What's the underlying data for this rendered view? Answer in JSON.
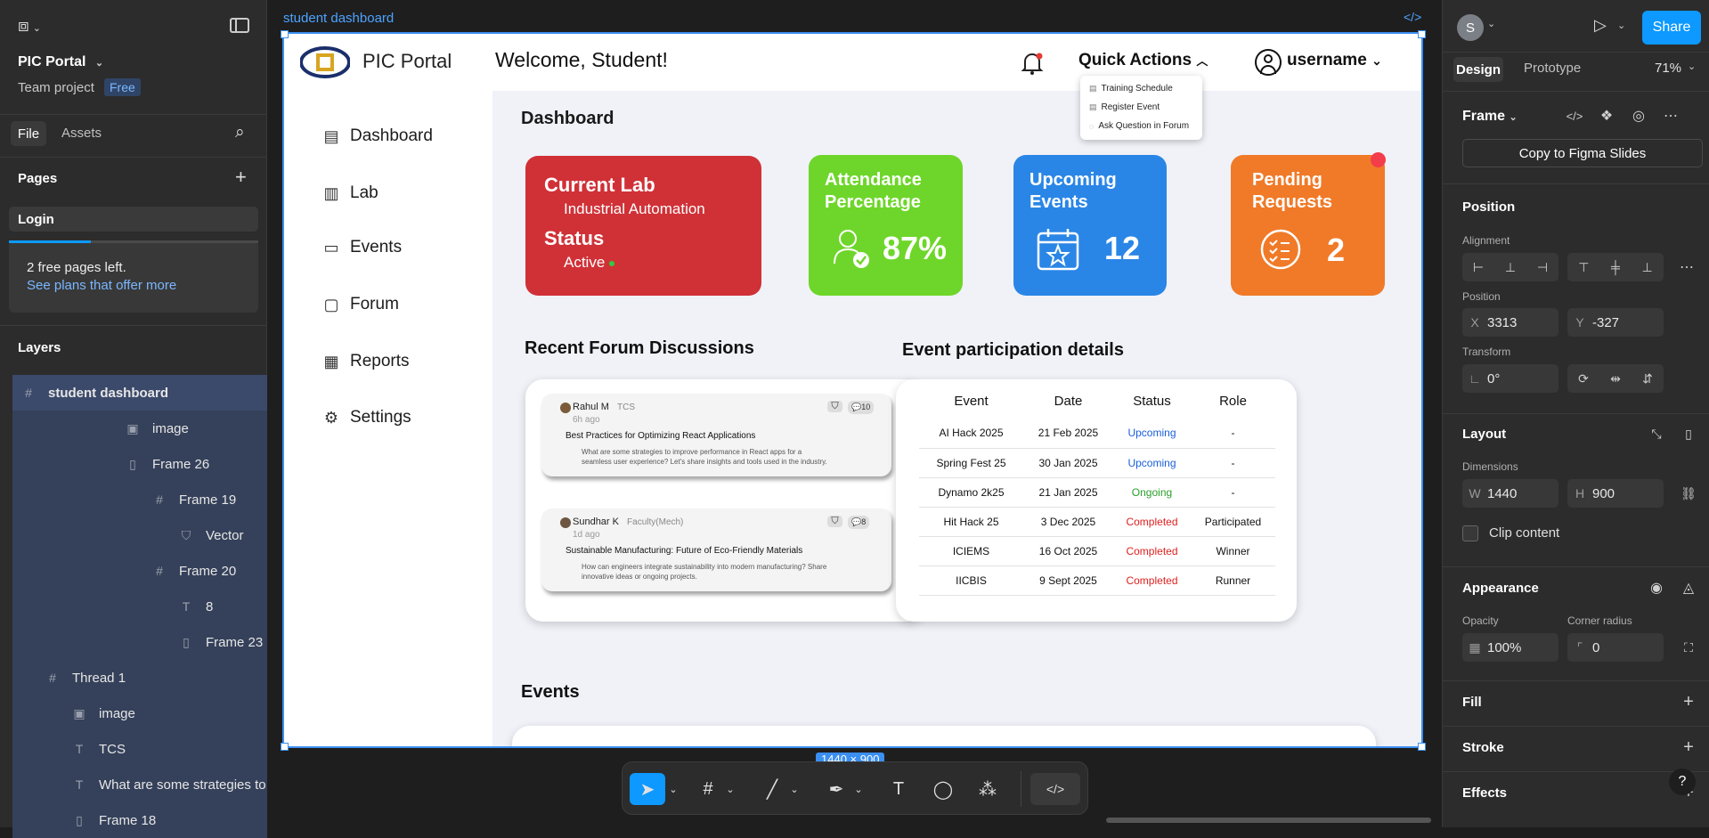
{
  "left_panel": {
    "project_name": "PIC Portal",
    "team_label": "Team project",
    "plan_badge": "Free",
    "tabs": [
      "File",
      "Assets"
    ],
    "pages_title": "Pages",
    "current_page": "Login",
    "free_pages_text": "2 free pages left.",
    "plans_link": "See plans that offer more",
    "free_pages_used_fraction": 0.33,
    "layers_title": "Layers",
    "layers": [
      {
        "name": "student dashboard",
        "icon": "frame-icon"
      },
      {
        "name": "image",
        "icon": "image-icon"
      },
      {
        "name": "Frame 26",
        "icon": "autolayout-icon"
      },
      {
        "name": "Frame 19",
        "icon": "frame-icon"
      },
      {
        "name": "Vector",
        "icon": "bookmark-icon"
      },
      {
        "name": "Frame 20",
        "icon": "frame-icon"
      },
      {
        "name": "8",
        "icon": "text-icon"
      },
      {
        "name": "Frame 23",
        "icon": "autolayout-icon"
      },
      {
        "name": "Thread 1",
        "icon": "frame-icon"
      },
      {
        "name": "image",
        "icon": "image-icon"
      },
      {
        "name": "TCS",
        "icon": "text-icon"
      },
      {
        "name": "What are some strategies to",
        "icon": "text-icon"
      },
      {
        "name": "Frame 18",
        "icon": "autolayout-icon"
      }
    ]
  },
  "canvas": {
    "frame_label": "student dashboard",
    "size_badge": "1440 × 900"
  },
  "app": {
    "logo_text": "PIC Portal",
    "welcome": "Welcome, Student!",
    "quick_actions_label": "Quick Actions",
    "quick_actions_items": [
      "Training Schedule",
      "Register Event",
      "Ask Question in Forum"
    ],
    "username": "username",
    "nav": [
      "Dashboard",
      "Lab",
      "Events",
      "Forum",
      "Reports",
      "Settings"
    ],
    "dashboard_title": "Dashboard",
    "cards": {
      "lab": {
        "title": "Current Lab",
        "lab_name": "Industrial Automation",
        "status_label": "Status",
        "status_value": "Active",
        "color": "#d03137"
      },
      "attendance": {
        "title_line1": "Attendance",
        "title_line2": "Percentage",
        "value": "87%",
        "color": "#6ed62a"
      },
      "upcoming": {
        "title_line1": "Upcoming",
        "title_line2": "Events",
        "value": "12",
        "color": "#2a86e6"
      },
      "pending": {
        "title_line1": "Pending",
        "title_line2": "Requests",
        "value": "2",
        "color": "#f07a28"
      }
    },
    "forum_title": "Recent Forum Discussions",
    "forum_posts": [
      {
        "author": "Rahul M",
        "org": "TCS",
        "time": "6h ago",
        "title": "Best Practices for Optimizing React Applications",
        "excerpt_line1": "What are some strategies to improve performance in React apps for a",
        "excerpt_line2": "seamless user experience? Let's share insights and tools used in the industry.",
        "comments": "10"
      },
      {
        "author": "Sundhar K",
        "org": "Faculty(Mech)",
        "time": "1d ago",
        "title": "Sustainable Manufacturing: Future of Eco-Friendly Materials",
        "excerpt_line1": "How can engineers integrate sustainability into modern manufacturing? Share",
        "excerpt_line2": "innovative ideas or ongoing projects.",
        "comments": "8"
      }
    ],
    "event_table_title": "Event participation details",
    "event_table_headers": [
      "Event",
      "Date",
      "Status",
      "Role"
    ],
    "event_rows": [
      {
        "event": "AI Hack 2025",
        "date": "21 Feb 2025",
        "status": "Upcoming",
        "role": "-"
      },
      {
        "event": "Spring Fest 25",
        "date": "30 Jan 2025",
        "status": "Upcoming",
        "role": "-"
      },
      {
        "event": "Dynamo 2k25",
        "date": "21 Jan 2025",
        "status": "Ongoing",
        "role": "-"
      },
      {
        "event": "Hit Hack 25",
        "date": "3 Dec 2025",
        "status": "Completed",
        "role": "Participated"
      },
      {
        "event": "ICIEMS",
        "date": "16 Oct 2025",
        "status": "Completed",
        "role": "Winner"
      },
      {
        "event": "IICBIS",
        "date": "9 Sept 2025",
        "status": "Completed",
        "role": "Runner"
      }
    ],
    "status_colors": {
      "Upcoming": "#1a5fd8",
      "Ongoing": "#2aa02a",
      "Completed": "#e02020"
    },
    "events_title": "Events"
  },
  "right_panel": {
    "avatar_letter": "S",
    "share_label": "Share",
    "tabs": [
      "Design",
      "Prototype"
    ],
    "zoom": "71%",
    "frame_label": "Frame",
    "copy_button": "Copy to Figma Slides",
    "position_title": "Position",
    "alignment_label": "Alignment",
    "position_label": "Position",
    "x_key": "X",
    "x_value": "3313",
    "y_key": "Y",
    "y_value": "-327",
    "transform_label": "Transform",
    "rotation_value": "0°",
    "layout_title": "Layout",
    "dimensions_label": "Dimensions",
    "w_key": "W",
    "w_value": "1440",
    "h_key": "H",
    "h_value": "900",
    "clip_label": "Clip content",
    "appearance_title": "Appearance",
    "opacity_label": "Opacity",
    "opacity_value": "100%",
    "radius_label": "Corner radius",
    "radius_value": "0",
    "fill_title": "Fill",
    "stroke_title": "Stroke",
    "effects_title": "Effects",
    "help": "?"
  },
  "colors": {
    "accent": "#0d99ff",
    "selection": "#3b8ff0"
  }
}
